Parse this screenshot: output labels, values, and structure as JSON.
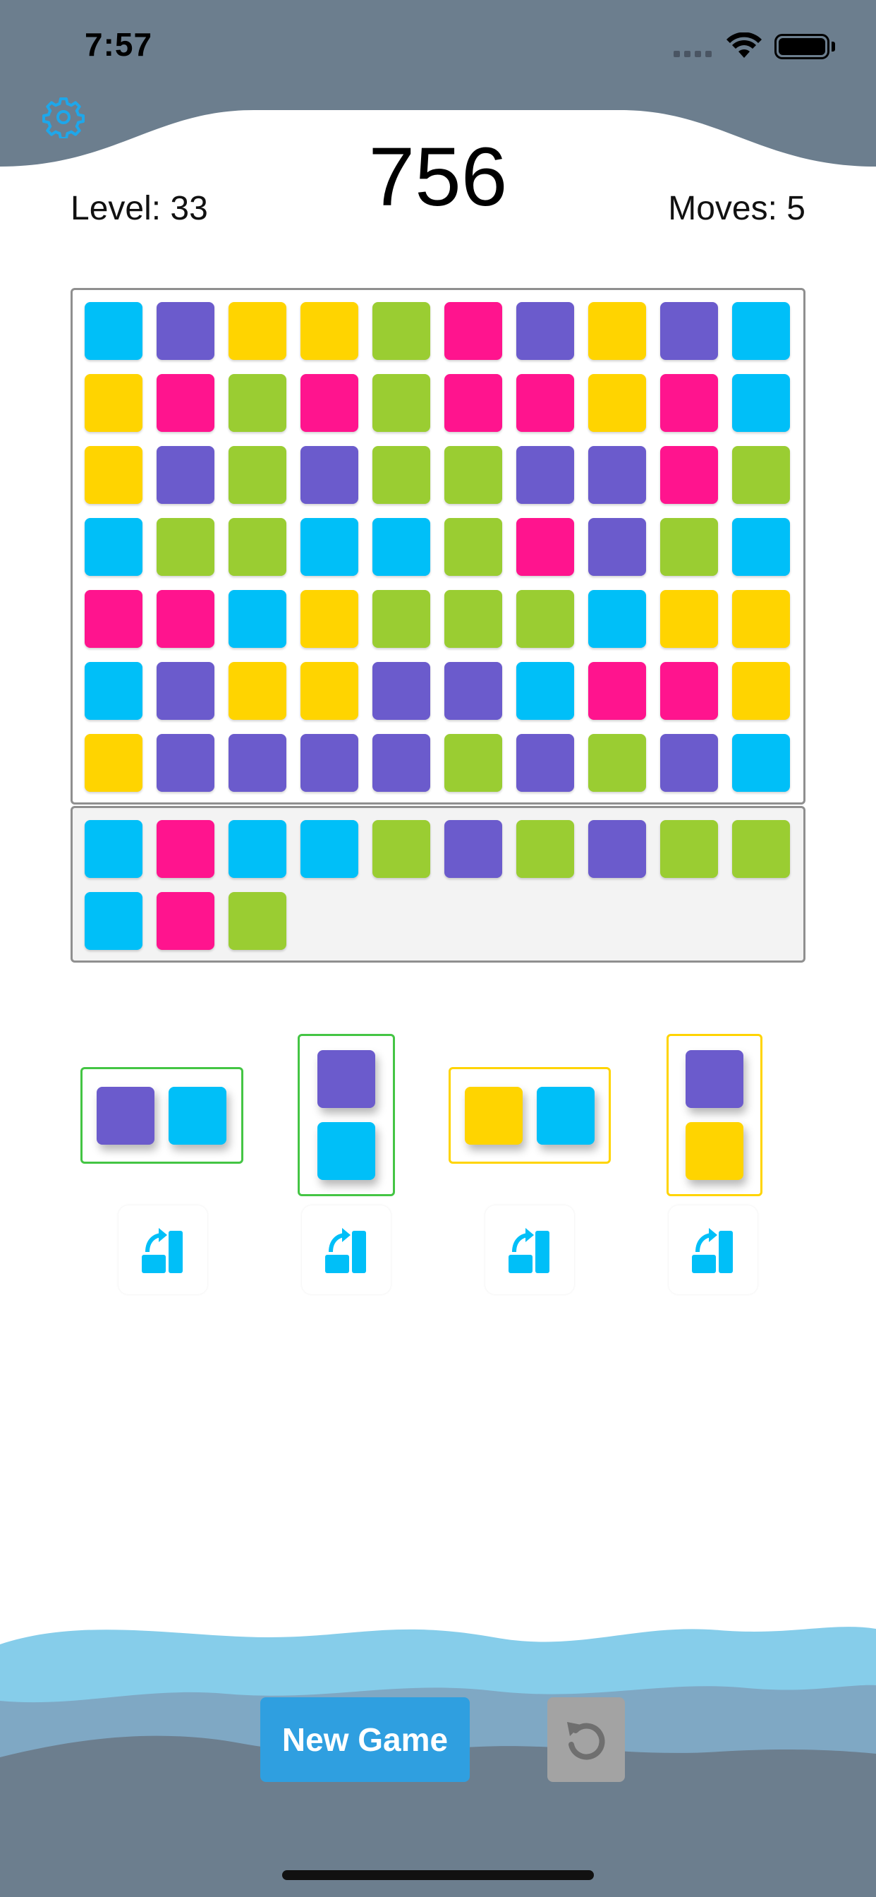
{
  "status_bar": {
    "time": "7:57"
  },
  "header": {
    "score": "756",
    "level_text": "Level: 33",
    "moves_text": "Moves: 5"
  },
  "colors": {
    "cyan": "#00bff8",
    "purple": "#6b5bcc",
    "yellow": "#ffd400",
    "green": "#9acd32",
    "magenta": "#ff148e",
    "header_bg": "#6c7e8e",
    "accent": "#2f9fe0"
  },
  "board": {
    "rows": [
      [
        "cyan",
        "purple",
        "yellow",
        "yellow",
        "green",
        "magenta",
        "purple",
        "yellow",
        "purple",
        "cyan"
      ],
      [
        "yellow",
        "magenta",
        "green",
        "magenta",
        "green",
        "magenta",
        "magenta",
        "yellow",
        "magenta",
        "cyan"
      ],
      [
        "yellow",
        "purple",
        "green",
        "purple",
        "green",
        "green",
        "purple",
        "purple",
        "magenta",
        "green"
      ],
      [
        "cyan",
        "green",
        "green",
        "cyan",
        "cyan",
        "green",
        "magenta",
        "purple",
        "green",
        "cyan"
      ],
      [
        "magenta",
        "magenta",
        "cyan",
        "yellow",
        "green",
        "green",
        "green",
        "cyan",
        "yellow",
        "yellow"
      ],
      [
        "cyan",
        "purple",
        "yellow",
        "yellow",
        "purple",
        "purple",
        "cyan",
        "magenta",
        "magenta",
        "yellow"
      ],
      [
        "yellow",
        "purple",
        "purple",
        "purple",
        "purple",
        "green",
        "purple",
        "green",
        "purple",
        "cyan"
      ]
    ]
  },
  "queue": {
    "tiles": [
      "cyan",
      "magenta",
      "cyan",
      "cyan",
      "green",
      "purple",
      "green",
      "purple",
      "green",
      "green",
      "cyan",
      "magenta",
      "green"
    ]
  },
  "pieces": [
    {
      "orientation": "horizontal",
      "tiles": [
        "purple",
        "cyan"
      ],
      "frame_color": "#44c544"
    },
    {
      "orientation": "vertical",
      "tiles": [
        "purple",
        "cyan"
      ],
      "frame_color": "#44c544"
    },
    {
      "orientation": "horizontal",
      "tiles": [
        "yellow",
        "cyan"
      ],
      "frame_color": "#ffd400"
    },
    {
      "orientation": "vertical",
      "tiles": [
        "purple",
        "yellow"
      ],
      "frame_color": "#ffd400"
    }
  ],
  "icons": {
    "settings": "gear-icon",
    "rotate": "rotate-piece-icon",
    "undo": "undo-icon"
  },
  "footer": {
    "new_game_label": "New Game"
  }
}
